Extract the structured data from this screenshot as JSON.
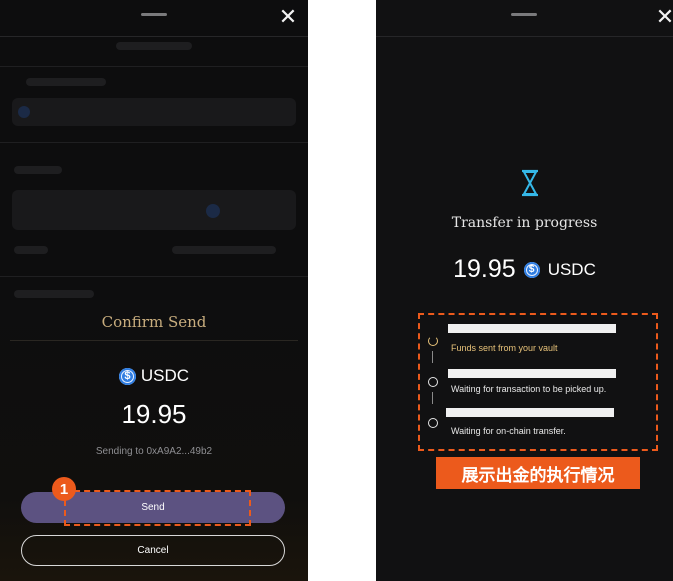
{
  "left_screen": {
    "confirm_sheet": {
      "title": "Confirm Send",
      "coin_symbol": "$",
      "coin_name": "USDC",
      "amount": "19.95",
      "subtitle": "Sending to 0xA9A2...49b2",
      "send_label": "Send",
      "cancel_label": "Cancel"
    },
    "step_badge": "1"
  },
  "right_screen": {
    "title": "Transfer in progress",
    "amount": "19.95",
    "coin_symbol": "$",
    "coin_name": "USDC",
    "steps": [
      {
        "text": "Funds sent from your vault",
        "state": "active"
      },
      {
        "text": "Waiting for transaction to be picked up.",
        "state": "pending"
      },
      {
        "text": "Waiting for on-chain transfer.",
        "state": "pending"
      }
    ]
  },
  "annotation_label": "展示出金的执行情况",
  "colors": {
    "accent_orange": "#ec5a1c",
    "send_button": "#5c5281",
    "gold_title": "#c8ad7e",
    "hourglass": "#35b8e8",
    "active_step": "#e8c37a"
  }
}
